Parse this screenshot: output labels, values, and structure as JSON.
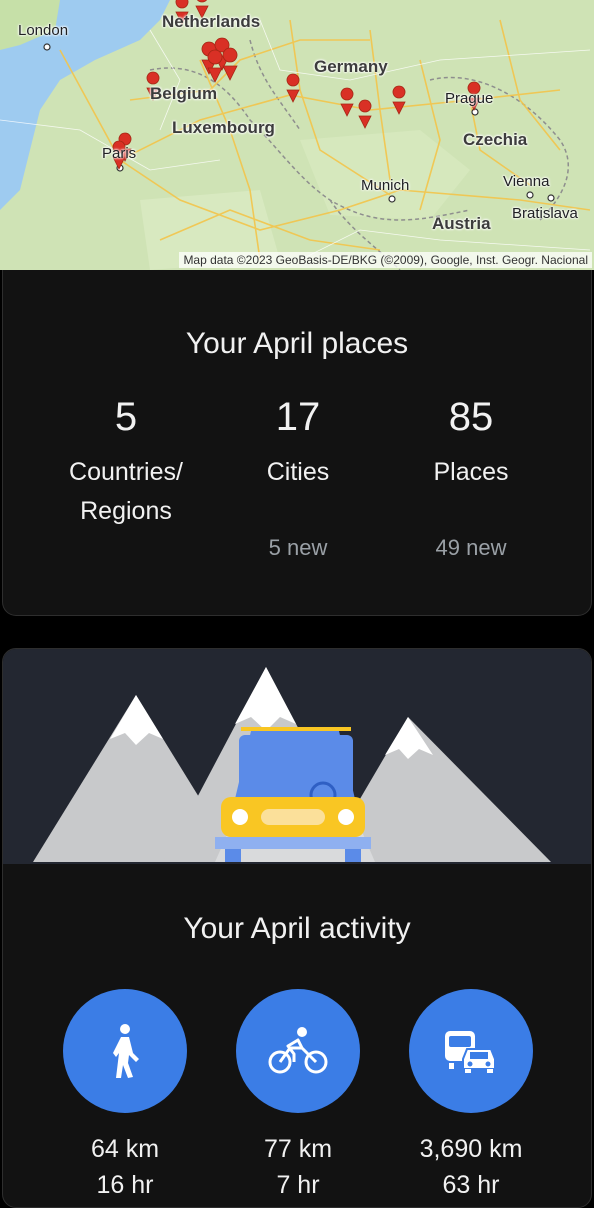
{
  "map": {
    "countries": [
      "Netherlands",
      "Germany",
      "Belgium",
      "Luxembourg",
      "Czechia",
      "Austria"
    ],
    "cities": [
      "London",
      "Paris",
      "Prague",
      "Munich",
      "Vienna",
      "Bratislava"
    ],
    "attribution": "Map data ©2023 GeoBasis-DE/BKG (©2009), Google, Inst. Geogr. Nacional"
  },
  "places": {
    "title": "Your April places",
    "stats": [
      {
        "value": "5",
        "label_line1": "Countries/",
        "label_line2": "Regions",
        "sub": ""
      },
      {
        "value": "17",
        "label_line1": "Cities",
        "label_line2": "",
        "sub": "5 new"
      },
      {
        "value": "85",
        "label_line1": "Places",
        "label_line2": "",
        "sub": "49 new"
      }
    ]
  },
  "activity": {
    "title": "Your April activity",
    "items": [
      {
        "icon": "walking-icon",
        "distance": "64 km",
        "time": "16 hr"
      },
      {
        "icon": "cycling-icon",
        "distance": "77 km",
        "time": "7 hr"
      },
      {
        "icon": "driving-transit-icon",
        "distance": "3,690 km",
        "time": "63 hr"
      }
    ]
  },
  "colors": {
    "background": "#000000",
    "card": "#121212",
    "accent_blue": "#3b7de6",
    "muted_text": "#9aa0a6",
    "pin_red": "#d93025"
  }
}
